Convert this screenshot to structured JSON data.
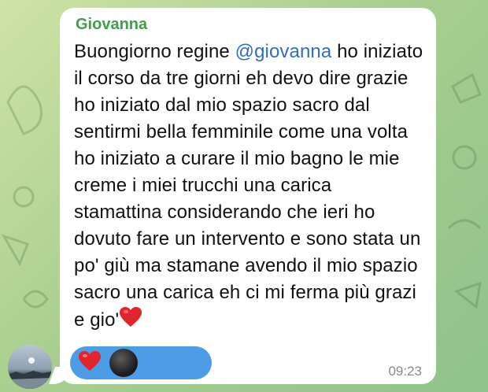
{
  "chat": {
    "background_colors": [
      "#cfe3a6",
      "#8fc28c"
    ],
    "message": {
      "sender": "Giovanna",
      "sender_color": "#3fa04a",
      "text_before_mention": "Buongiorno regine ",
      "mention": "@giovanna",
      "mention_color": "#2f6fc2",
      "text_after_mention": " ho iniziato il corso da tre giorni eh devo dire grazie ho iniziato dal mio spazio sacro dal sentirmi bella femminile come una volta ho iniziato a curare il mio bagno le mie creme i miei trucchi una carica stamattina considerando che ieri ho dovuto fare un intervento e sono stata un po' giù ma stamane avendo il mio spazio sacro una carica eh ci mi ferma più grazi e gio'",
      "trailing_emoji": "red-heart-icon",
      "time": "09:23",
      "reactions": {
        "emoji": "red-heart-icon",
        "color": "#4d9de6",
        "reactor_avatar": "user-avatar"
      }
    },
    "sender_avatar": "user-avatar"
  }
}
